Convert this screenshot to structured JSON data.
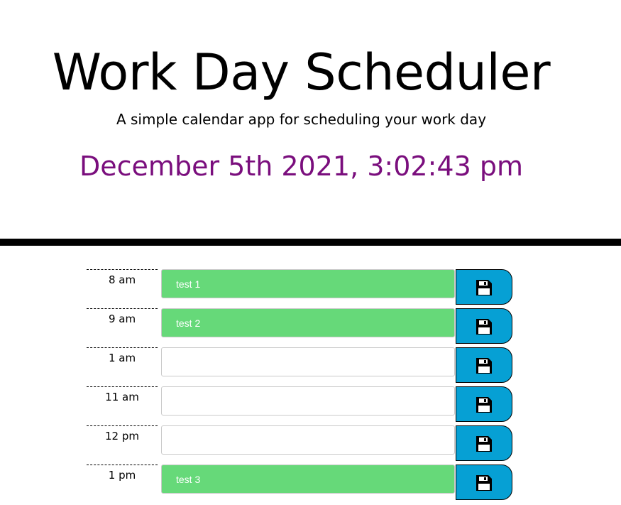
{
  "header": {
    "title": "Work Day Scheduler",
    "subtitle": "A simple calendar app for scheduling your work day",
    "current_datetime": "December 5th 2021, 3:02:43 pm"
  },
  "colors": {
    "datetime": "#7a0e7d",
    "present_or_past": "#66d979",
    "future": "#ffffff",
    "save_button": "#06a0d4",
    "divider": "#000000"
  },
  "timeblocks": [
    {
      "hour": "8 am",
      "text": "test 1",
      "state": "past"
    },
    {
      "hour": "9 am",
      "text": "test 2",
      "state": "past"
    },
    {
      "hour": "1 am",
      "text": "",
      "state": "future"
    },
    {
      "hour": "11 am",
      "text": "",
      "state": "future"
    },
    {
      "hour": "12 pm",
      "text": "",
      "state": "future"
    },
    {
      "hour": "1 pm",
      "text": "test 3",
      "state": "past"
    }
  ],
  "icons": {
    "save": "floppy-disk-icon"
  }
}
